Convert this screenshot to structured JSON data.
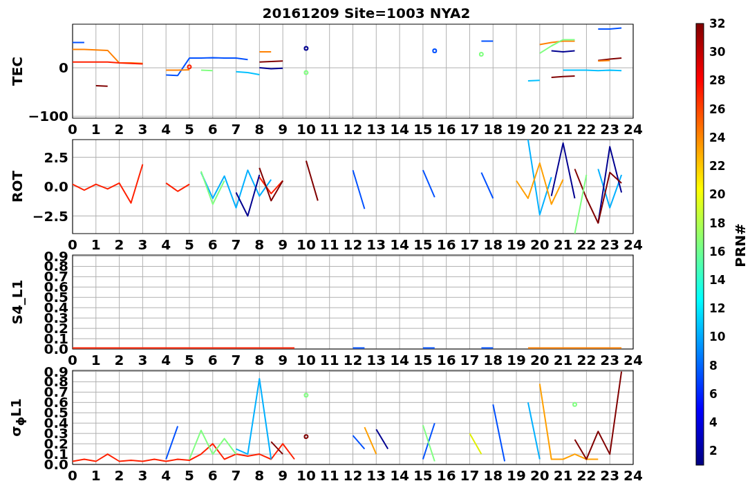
{
  "title": "20161209 Site=1003 NYA2",
  "panels": [
    {
      "chart_data": {
        "type": "line",
        "grid": true,
        "ylabel": "TEC",
        "x": [
          0,
          0.5,
          1,
          1.5,
          2,
          2.5,
          3,
          3.5,
          4,
          4.5,
          5,
          5.5,
          6,
          6.5,
          7,
          7.5,
          8,
          8.5,
          9,
          9.5,
          10,
          10.5,
          11,
          11.5,
          12,
          12.5,
          13,
          13.5,
          14,
          14.5,
          15,
          15.5,
          16,
          16.5,
          17,
          17.5,
          18,
          18.5,
          19,
          19.5,
          20,
          20.5,
          21,
          21.5,
          22,
          22.5,
          23,
          23.5
        ],
        "xlim": [
          0,
          24
        ],
        "ylim": [
          -104,
          90
        ],
        "xticks": [
          0,
          1,
          2,
          3,
          4,
          5,
          6,
          7,
          8,
          9,
          10,
          11,
          12,
          13,
          14,
          15,
          16,
          17,
          18,
          19,
          20,
          21,
          22,
          23,
          24
        ],
        "yticks": [
          {
            "value": -100,
            "label": "−100"
          },
          {
            "value": 0,
            "label": "0"
          }
        ],
        "series": [
          {
            "color": "#800000",
            "values": [
              null,
              null,
              -37,
              -38,
              null,
              null,
              null,
              null,
              null,
              null,
              null,
              null,
              null,
              null,
              null,
              null,
              12,
              13,
              14,
              null,
              null,
              null,
              null,
              null,
              null,
              null,
              null,
              null,
              null,
              null,
              null,
              null,
              null,
              null,
              null,
              null,
              null,
              null,
              null,
              null,
              null,
              -20,
              -18,
              -17,
              null,
              15,
              18,
              20
            ]
          },
          {
            "color": "#0050ff",
            "values": [
              52,
              52,
              null,
              null,
              null,
              null,
              null,
              null,
              -15,
              -16,
              20,
              20,
              21,
              20,
              20,
              17,
              null,
              null,
              null,
              null,
              null,
              null,
              null,
              null,
              null,
              null,
              null,
              null,
              null,
              null,
              null,
              35,
              null,
              null,
              null,
              55,
              55,
              null,
              null,
              null,
              null,
              null,
              null,
              null,
              null,
              80,
              80,
              82
            ]
          },
          {
            "color": "#ff8000",
            "values": [
              38,
              38,
              37,
              36,
              10,
              10,
              9,
              null,
              -5,
              -5,
              -4,
              null,
              null,
              null,
              null,
              null,
              33,
              33,
              null,
              null,
              null,
              null,
              null,
              null,
              null,
              null,
              null,
              null,
              null,
              null,
              null,
              null,
              null,
              null,
              null,
              null,
              null,
              null,
              null,
              null,
              48,
              52,
              55,
              55,
              null,
              14,
              15,
              null
            ]
          },
          {
            "color": "#00c0ff",
            "values": [
              null,
              null,
              null,
              null,
              null,
              null,
              null,
              null,
              null,
              null,
              null,
              null,
              null,
              null,
              -8,
              -10,
              -14,
              null,
              null,
              null,
              null,
              null,
              null,
              null,
              null,
              null,
              null,
              null,
              null,
              null,
              null,
              null,
              null,
              null,
              null,
              null,
              null,
              null,
              null,
              -27,
              -26,
              null,
              -5,
              -5,
              -5,
              -6,
              -5,
              -6
            ]
          },
          {
            "color": "#80ff80",
            "values": [
              null,
              null,
              null,
              null,
              null,
              null,
              null,
              null,
              null,
              null,
              null,
              -5,
              -6,
              null,
              null,
              null,
              null,
              null,
              null,
              null,
              -10,
              null,
              null,
              null,
              null,
              null,
              null,
              null,
              null,
              null,
              null,
              null,
              null,
              null,
              null,
              28,
              null,
              null,
              null,
              null,
              30,
              45,
              58,
              58,
              null,
              null,
              null,
              null
            ]
          },
          {
            "color": "#ff2000",
            "values": [
              12,
              12,
              12,
              12,
              10,
              9,
              8,
              null,
              null,
              null,
              2,
              null,
              null,
              null,
              null,
              null,
              null,
              null,
              null,
              null,
              null,
              null,
              null,
              null,
              null,
              null,
              null,
              null,
              null,
              null,
              null,
              null,
              null,
              null,
              null,
              null,
              null,
              null,
              null,
              null,
              null,
              null,
              null,
              null,
              null,
              null,
              null,
              null
            ]
          },
          {
            "color": "#000090",
            "values": [
              null,
              null,
              null,
              null,
              null,
              null,
              null,
              null,
              null,
              null,
              null,
              null,
              null,
              null,
              null,
              null,
              0,
              -2,
              -1,
              null,
              40,
              null,
              null,
              null,
              null,
              null,
              null,
              null,
              null,
              null,
              null,
              null,
              null,
              null,
              null,
              null,
              null,
              null,
              null,
              null,
              null,
              35,
              33,
              35,
              null,
              null,
              null,
              null
            ]
          }
        ]
      }
    },
    {
      "chart_data": {
        "type": "line",
        "grid": true,
        "ylabel": "ROT",
        "x": [
          0,
          0.5,
          1,
          1.5,
          2,
          2.5,
          3,
          3.5,
          4,
          4.5,
          5,
          5.5,
          6,
          6.5,
          7,
          7.5,
          8,
          8.5,
          9,
          9.5,
          10,
          10.5,
          11,
          11.5,
          12,
          12.5,
          13,
          13.5,
          14,
          14.5,
          15,
          15.5,
          16,
          16.5,
          17,
          17.5,
          18,
          18.5,
          19,
          19.5,
          20,
          20.5,
          21,
          21.5,
          22,
          22.5,
          23,
          23.5
        ],
        "xlim": [
          0,
          24
        ],
        "ylim": [
          -4,
          4
        ],
        "xticks": [
          0,
          1,
          2,
          3,
          4,
          5,
          6,
          7,
          8,
          9,
          10,
          11,
          12,
          13,
          14,
          15,
          16,
          17,
          18,
          19,
          20,
          21,
          22,
          23,
          24
        ],
        "yticks": [
          {
            "value": -2.5,
            "label": "−2.5"
          },
          {
            "value": 0,
            "label": "0.0"
          },
          {
            "value": 2.5,
            "label": "2.5"
          }
        ],
        "series": [
          {
            "color": "#ff2000",
            "values": [
              0.2,
              -0.3,
              0.2,
              -0.2,
              0.3,
              -1.4,
              1.9,
              null,
              0.3,
              -0.4,
              0.2,
              null,
              null,
              null,
              null,
              null,
              0.8,
              -0.6,
              0.5,
              null,
              null,
              null,
              null,
              null,
              null,
              null,
              null,
              null,
              null,
              null,
              null,
              null,
              null,
              null,
              null,
              null,
              null,
              null,
              null,
              null,
              null,
              null,
              null,
              null,
              null,
              null,
              null,
              null
            ]
          },
          {
            "color": "#00b0ff",
            "values": [
              null,
              null,
              null,
              null,
              null,
              null,
              null,
              null,
              null,
              null,
              null,
              1.2,
              -1.0,
              0.9,
              -1.8,
              1.4,
              -0.8,
              0.6,
              null,
              null,
              null,
              null,
              null,
              null,
              null,
              null,
              null,
              null,
              null,
              null,
              null,
              null,
              null,
              null,
              null,
              null,
              null,
              null,
              null,
              4.0,
              -2.4,
              0.8,
              null,
              null,
              null,
              1.5,
              -1.8,
              1.0
            ]
          },
          {
            "color": "#000090",
            "values": [
              null,
              null,
              null,
              null,
              null,
              null,
              null,
              null,
              null,
              null,
              null,
              null,
              null,
              null,
              -0.5,
              -2.5,
              1.0,
              null,
              null,
              null,
              null,
              null,
              null,
              null,
              null,
              null,
              null,
              null,
              null,
              null,
              null,
              null,
              null,
              null,
              null,
              null,
              null,
              null,
              null,
              null,
              null,
              -0.8,
              3.7,
              -1.0,
              null,
              -3.1,
              3.4,
              -0.5
            ]
          },
          {
            "color": "#800000",
            "values": [
              null,
              null,
              null,
              null,
              null,
              null,
              null,
              null,
              null,
              null,
              null,
              null,
              null,
              null,
              null,
              null,
              1.6,
              -1.2,
              0.5,
              null,
              2.2,
              -1.2,
              null,
              null,
              null,
              null,
              null,
              null,
              null,
              null,
              null,
              null,
              null,
              null,
              null,
              null,
              null,
              null,
              null,
              null,
              null,
              null,
              null,
              1.5,
              -1.0,
              -3.1,
              1.2,
              0.3
            ]
          },
          {
            "color": "#ffa000",
            "values": [
              null,
              null,
              null,
              null,
              null,
              null,
              null,
              null,
              null,
              null,
              null,
              null,
              null,
              null,
              null,
              null,
              null,
              null,
              null,
              null,
              null,
              null,
              null,
              null,
              null,
              null,
              null,
              null,
              null,
              null,
              null,
              null,
              null,
              null,
              null,
              null,
              null,
              null,
              0.5,
              -1.0,
              2.0,
              -1.5,
              0.6,
              null,
              null,
              null,
              null,
              null
            ]
          },
          {
            "color": "#0050ff",
            "values": [
              null,
              null,
              null,
              null,
              null,
              null,
              null,
              null,
              null,
              null,
              null,
              null,
              null,
              null,
              null,
              null,
              null,
              null,
              null,
              null,
              null,
              null,
              null,
              null,
              1.4,
              -1.9,
              null,
              null,
              null,
              null,
              1.4,
              -0.9,
              null,
              null,
              null,
              1.2,
              -1.0,
              null,
              null,
              null,
              null,
              null,
              null,
              null,
              null,
              null,
              null,
              null
            ]
          },
          {
            "color": "#80ff80",
            "values": [
              null,
              null,
              null,
              null,
              null,
              null,
              null,
              null,
              null,
              null,
              null,
              1.3,
              -1.5,
              0.5,
              null,
              null,
              null,
              null,
              null,
              null,
              null,
              null,
              null,
              null,
              null,
              null,
              null,
              null,
              null,
              null,
              null,
              null,
              null,
              null,
              null,
              null,
              null,
              null,
              null,
              null,
              null,
              null,
              null,
              -4.0,
              1.0,
              null,
              null,
              null
            ]
          }
        ]
      }
    },
    {
      "chart_data": {
        "type": "line",
        "grid": true,
        "ylabel": "S4_L1",
        "x": [
          0,
          0.5,
          1,
          1.5,
          2,
          2.5,
          3,
          3.5,
          4,
          4.5,
          5,
          5.5,
          6,
          6.5,
          7,
          7.5,
          8,
          8.5,
          9,
          9.5,
          10,
          10.5,
          11,
          11.5,
          12,
          12.5,
          13,
          13.5,
          14,
          14.5,
          15,
          15.5,
          16,
          16.5,
          17,
          17.5,
          18,
          18.5,
          19,
          19.5,
          20,
          20.5,
          21,
          21.5,
          22,
          22.5,
          23,
          23.5
        ],
        "xlim": [
          0,
          24
        ],
        "ylim": [
          0,
          0.91
        ],
        "xticks": [
          0,
          1,
          2,
          3,
          4,
          5,
          6,
          7,
          8,
          9,
          10,
          11,
          12,
          13,
          14,
          15,
          16,
          17,
          18,
          19,
          20,
          21,
          22,
          23,
          24
        ],
        "yticks": [
          {
            "value": 0,
            "label": "0.0"
          },
          {
            "value": 0.1,
            "label": "0.1"
          },
          {
            "value": 0.2,
            "label": "0.2"
          },
          {
            "value": 0.3,
            "label": "0.3"
          },
          {
            "value": 0.4,
            "label": "0.4"
          },
          {
            "value": 0.5,
            "label": "0.5"
          },
          {
            "value": 0.6,
            "label": "0.6"
          },
          {
            "value": 0.7,
            "label": "0.7"
          },
          {
            "value": 0.8,
            "label": "0.8"
          },
          {
            "value": 0.9,
            "label": "0.9"
          }
        ],
        "series": [
          {
            "color": "#ff2000",
            "values": [
              0.01,
              0.01,
              0.01,
              0.01,
              0.01,
              0.01,
              0.01,
              0.01,
              0.01,
              0.01,
              0.01,
              0.01,
              0.01,
              0.01,
              0.01,
              0.01,
              0.01,
              0.01,
              0.01,
              0.01,
              null,
              null,
              null,
              null,
              null,
              null,
              null,
              null,
              null,
              null,
              null,
              null,
              null,
              null,
              null,
              null,
              null,
              null,
              null,
              null,
              null,
              null,
              null,
              null,
              null,
              null,
              null,
              null
            ]
          },
          {
            "color": "#ff8000",
            "values": [
              null,
              null,
              null,
              null,
              null,
              null,
              null,
              null,
              null,
              null,
              null,
              null,
              null,
              null,
              null,
              null,
              null,
              null,
              null,
              null,
              null,
              null,
              null,
              null,
              null,
              null,
              null,
              null,
              null,
              null,
              null,
              null,
              null,
              null,
              null,
              null,
              null,
              null,
              null,
              0.01,
              0.01,
              0.01,
              0.01,
              0.01,
              0.01,
              0.01,
              0.01,
              0.01
            ]
          },
          {
            "color": "#0050ff",
            "values": [
              null,
              null,
              null,
              null,
              null,
              null,
              null,
              null,
              null,
              null,
              null,
              null,
              null,
              null,
              null,
              null,
              null,
              null,
              null,
              null,
              null,
              null,
              null,
              null,
              0.01,
              0.01,
              null,
              null,
              null,
              null,
              0.01,
              0.01,
              null,
              null,
              null,
              0.01,
              0.01,
              null,
              null,
              null,
              null,
              null,
              null,
              null,
              null,
              null,
              null,
              null
            ]
          }
        ]
      }
    },
    {
      "chart_data": {
        "type": "line",
        "grid": true,
        "ylabel": "σ$_{ϕ}$L1",
        "x": [
          0,
          0.5,
          1,
          1.5,
          2,
          2.5,
          3,
          3.5,
          4,
          4.5,
          5,
          5.5,
          6,
          6.5,
          7,
          7.5,
          8,
          8.5,
          9,
          9.5,
          10,
          10.5,
          11,
          11.5,
          12,
          12.5,
          13,
          13.5,
          14,
          14.5,
          15,
          15.5,
          16,
          16.5,
          17,
          17.5,
          18,
          18.5,
          19,
          19.5,
          20,
          20.5,
          21,
          21.5,
          22,
          22.5,
          23,
          23.5
        ],
        "xlim": [
          0,
          24
        ],
        "ylim": [
          0,
          0.91
        ],
        "xticks": [
          0,
          1,
          2,
          3,
          4,
          5,
          6,
          7,
          8,
          9,
          10,
          11,
          12,
          13,
          14,
          15,
          16,
          17,
          18,
          19,
          20,
          21,
          22,
          23,
          24
        ],
        "yticks": [
          {
            "value": 0,
            "label": "0.0"
          },
          {
            "value": 0.1,
            "label": "0.1"
          },
          {
            "value": 0.2,
            "label": "0.2"
          },
          {
            "value": 0.3,
            "label": "0.3"
          },
          {
            "value": 0.4,
            "label": "0.4"
          },
          {
            "value": 0.5,
            "label": "0.5"
          },
          {
            "value": 0.6,
            "label": "0.6"
          },
          {
            "value": 0.7,
            "label": "0.7"
          },
          {
            "value": 0.8,
            "label": "0.8"
          },
          {
            "value": 0.9,
            "label": "0.9"
          }
        ],
        "series": [
          {
            "color": "#ff2000",
            "values": [
              0.03,
              0.05,
              0.03,
              0.1,
              0.03,
              0.04,
              0.03,
              0.05,
              0.03,
              0.05,
              0.04,
              0.1,
              0.2,
              0.05,
              0.1,
              0.08,
              0.1,
              0.05,
              0.2,
              0.05,
              null,
              null,
              null,
              null,
              null,
              null,
              null,
              null,
              null,
              null,
              null,
              null,
              null,
              null,
              null,
              null,
              null,
              null,
              null,
              null,
              null,
              null,
              null,
              null,
              null,
              null,
              null,
              null
            ]
          },
          {
            "color": "#00b0ff",
            "values": [
              null,
              null,
              null,
              null,
              null,
              null,
              null,
              null,
              null,
              null,
              null,
              null,
              null,
              null,
              0.15,
              0.1,
              0.83,
              0.05,
              null,
              null,
              null,
              null,
              null,
              null,
              null,
              null,
              null,
              null,
              null,
              null,
              null,
              null,
              null,
              null,
              null,
              null,
              null,
              null,
              null,
              0.6,
              0.05,
              null,
              null,
              null,
              null,
              null,
              null,
              null
            ]
          },
          {
            "color": "#0050ff",
            "values": [
              null,
              null,
              null,
              null,
              null,
              null,
              null,
              null,
              0.05,
              0.37,
              null,
              null,
              null,
              null,
              null,
              null,
              null,
              null,
              null,
              null,
              null,
              null,
              null,
              null,
              0.28,
              0.15,
              null,
              null,
              null,
              null,
              0.05,
              0.4,
              null,
              null,
              null,
              null,
              0.58,
              0.03,
              null,
              null,
              null,
              null,
              null,
              null,
              null,
              null,
              null,
              null
            ]
          },
          {
            "color": "#ffa000",
            "values": [
              null,
              null,
              null,
              null,
              null,
              null,
              null,
              null,
              null,
              null,
              null,
              null,
              null,
              null,
              null,
              null,
              null,
              null,
              null,
              null,
              null,
              null,
              null,
              null,
              null,
              0.36,
              0.1,
              null,
              null,
              null,
              null,
              null,
              null,
              null,
              null,
              null,
              null,
              null,
              null,
              null,
              0.78,
              0.05,
              0.05,
              0.1,
              0.05,
              0.05,
              null,
              null
            ]
          },
          {
            "color": "#800000",
            "values": [
              null,
              null,
              null,
              null,
              null,
              null,
              null,
              null,
              null,
              null,
              null,
              null,
              null,
              null,
              null,
              null,
              null,
              0.22,
              0.1,
              null,
              0.27,
              null,
              null,
              null,
              null,
              null,
              null,
              null,
              null,
              null,
              null,
              null,
              null,
              null,
              null,
              null,
              null,
              null,
              null,
              null,
              null,
              null,
              null,
              0.24,
              0.05,
              0.32,
              0.1,
              0.9
            ]
          },
          {
            "color": "#80ff80",
            "values": [
              null,
              null,
              null,
              null,
              null,
              null,
              null,
              null,
              null,
              null,
              0.05,
              0.33,
              0.1,
              0.25,
              0.1,
              null,
              null,
              null,
              null,
              null,
              0.67,
              null,
              null,
              null,
              null,
              null,
              null,
              null,
              null,
              null,
              0.38,
              0.03,
              null,
              null,
              null,
              null,
              null,
              null,
              null,
              null,
              null,
              null,
              null,
              0.58,
              null,
              null,
              null,
              null
            ]
          },
          {
            "color": "#000090",
            "values": [
              null,
              null,
              null,
              null,
              null,
              null,
              null,
              null,
              null,
              null,
              null,
              null,
              null,
              null,
              null,
              null,
              null,
              null,
              null,
              null,
              null,
              null,
              null,
              null,
              null,
              null,
              0.34,
              0.15,
              null,
              null,
              null,
              null,
              null,
              null,
              null,
              null,
              null,
              null,
              null,
              null,
              null,
              null,
              null,
              null,
              null,
              null,
              null,
              null
            ]
          },
          {
            "color": "#e0f000",
            "values": [
              null,
              null,
              null,
              null,
              null,
              null,
              null,
              null,
              null,
              null,
              null,
              null,
              null,
              null,
              null,
              null,
              null,
              null,
              null,
              null,
              null,
              null,
              null,
              null,
              null,
              null,
              null,
              null,
              null,
              null,
              null,
              null,
              null,
              null,
              0.3,
              0.1,
              null,
              null,
              null,
              null,
              null,
              null,
              null,
              null,
              null,
              null,
              null,
              null
            ]
          }
        ]
      }
    }
  ],
  "colorbar": {
    "label": "PRN#",
    "ticks": [
      "32",
      "30",
      "28",
      "26",
      "24",
      "22",
      "20",
      "18",
      "16",
      "14",
      "12",
      "10",
      "8",
      "6",
      "4",
      "2"
    ]
  }
}
